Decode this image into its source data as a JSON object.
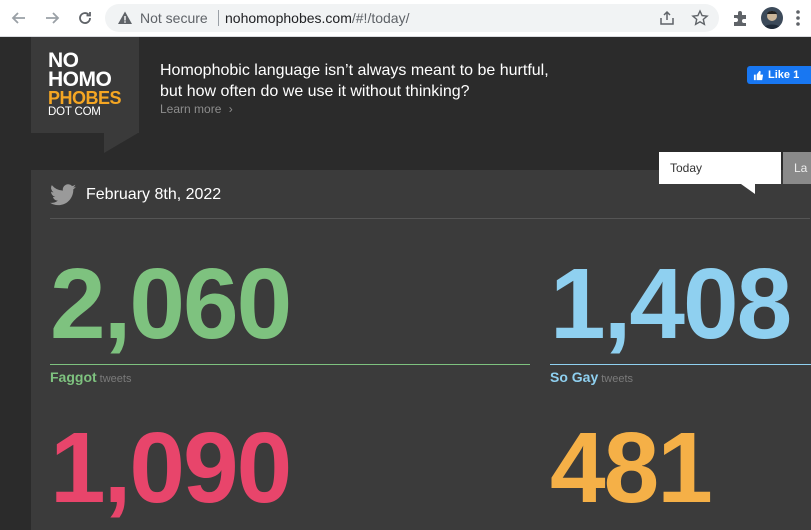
{
  "browser": {
    "security_label": "Not secure",
    "url_host": "nohomophobes.com",
    "url_path": "/#!/today/",
    "icons": [
      "back-arrow-icon",
      "forward-arrow-icon",
      "reload-icon",
      "warning-icon",
      "share-icon",
      "star-icon",
      "puzzle-extension-icon",
      "avatar",
      "more-menu-icon"
    ]
  },
  "site": {
    "logo": {
      "line1": "NO",
      "line2": "HOMO",
      "line3": "PHOBES",
      "line4": "DOT COM"
    },
    "headline_line1": "Homophobic language isn’t always meant to be hurtful,",
    "headline_line2": "but how often do we use it without thinking?",
    "learn_more": "Learn more",
    "facebook_like": "Like 1"
  },
  "panel": {
    "tabs": [
      {
        "label": "Today",
        "active": true
      },
      {
        "label": "La",
        "active": false
      }
    ],
    "date": "February 8th, 2022",
    "stats": [
      {
        "count": "2,060",
        "term": "Faggot",
        "suffix": "tweets",
        "color": "#7ec27f"
      },
      {
        "count": "1,408",
        "term": "So Gay",
        "suffix": "tweets",
        "color": "#8fd0f0"
      },
      {
        "count": "1,090",
        "term": "",
        "suffix": "",
        "color": "#e8456b"
      },
      {
        "count": "481",
        "term": "",
        "suffix": "",
        "color": "#f5b047"
      }
    ]
  },
  "colors": {
    "background": "#2b2b2b",
    "panel": "#3b3b3b",
    "logo_accent": "#f5a623",
    "facebook": "#1877f2"
  }
}
